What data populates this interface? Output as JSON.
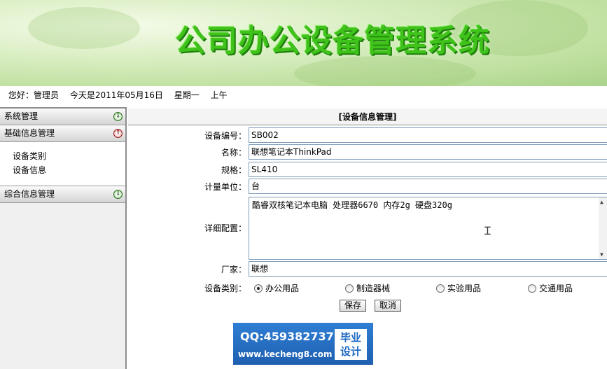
{
  "banner": {
    "title": "公司办公设备管理系统"
  },
  "status": {
    "greeting": "您好：管理员",
    "date": "今天是2011年05月16日",
    "weekday": "星期一",
    "period": "上午"
  },
  "sidebar": {
    "sections": [
      {
        "label": "系统管理"
      },
      {
        "label": "基础信息管理",
        "items": [
          "设备类别",
          "设备信息"
        ]
      },
      {
        "label": "综合信息管理"
      }
    ]
  },
  "main": {
    "title": "[设备信息管理]",
    "fields": {
      "code": {
        "label": "设备编号：",
        "value": "SB002"
      },
      "name": {
        "label": "名称：",
        "value": "联想笔记本ThinkPad"
      },
      "spec": {
        "label": "规格：",
        "value": "SL410"
      },
      "unit": {
        "label": "计量单位：",
        "value": "台"
      },
      "detail": {
        "label": "详细配置：",
        "value": "酷睿双核笔记本电脑 处理器6670 内存2g 硬盘320g"
      },
      "vendor": {
        "label": "厂家：",
        "value": "联想"
      },
      "category": {
        "label": "设备类别：",
        "options": [
          "办公用品",
          "制造器械",
          "实验用品",
          "交通用品"
        ],
        "selected": "办公用品"
      }
    },
    "buttons": {
      "save": "保存",
      "cancel": "取消"
    }
  },
  "promo": {
    "qq": "QQ:459382737",
    "url": "www.kecheng8.com",
    "badge_line1": "毕业",
    "badge_line2": "设计"
  }
}
